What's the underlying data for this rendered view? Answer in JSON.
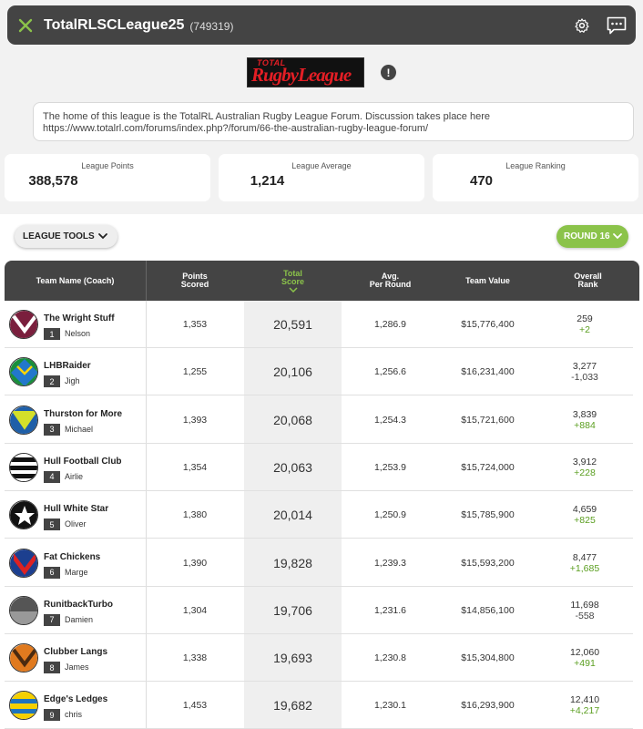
{
  "header": {
    "title": "TotalRLSCLeague25",
    "league_id": "(749319)"
  },
  "logo": {
    "line1": "TOTAL",
    "line2": "RugbyLeague"
  },
  "description": "The home of this league is the TotalRL Australian Rugby League Forum. Discussion takes place here https://www.totalrl.com/forums/index.php?/forum/66-the-australian-rugby-league-forum/",
  "stats": [
    {
      "label": "League Points",
      "value": "388,578"
    },
    {
      "label": "League Average",
      "value": "1,214"
    },
    {
      "label": "League Ranking",
      "value": "470"
    }
  ],
  "controls": {
    "tools_label": "LEAGUE TOOLS",
    "round_label": "ROUND 16"
  },
  "columns": {
    "team": "Team Name (Coach)",
    "points_l1": "Points",
    "points_l2": "Scored",
    "total_l1": "Total",
    "total_l2": "Score",
    "avg_l1": "Avg.",
    "avg_l2": "Per Round",
    "value": "Team Value",
    "overall_l1": "Overall",
    "overall_l2": "Rank"
  },
  "accent": "#8bc34a",
  "rows": [
    {
      "team": "The Wright Stuff",
      "rank": "1",
      "coach": "Nelson",
      "points": "1,353",
      "total": "20,591",
      "avg": "1,286.9",
      "value": "$15,776,400",
      "overall": "259",
      "change": "+2",
      "dir": "up"
    },
    {
      "team": "LHBRaider",
      "rank": "2",
      "coach": "Jigh",
      "points": "1,255",
      "total": "20,106",
      "avg": "1,256.6",
      "value": "$16,231,400",
      "overall": "3,277",
      "change": "-1,033",
      "dir": "down"
    },
    {
      "team": "Thurston for More",
      "rank": "3",
      "coach": "Michael",
      "points": "1,393",
      "total": "20,068",
      "avg": "1,254.3",
      "value": "$15,721,600",
      "overall": "3,839",
      "change": "+884",
      "dir": "up"
    },
    {
      "team": "Hull Football Club",
      "rank": "4",
      "coach": "Airlie",
      "points": "1,354",
      "total": "20,063",
      "avg": "1,253.9",
      "value": "$15,724,000",
      "overall": "3,912",
      "change": "+228",
      "dir": "up"
    },
    {
      "team": "Hull White Star",
      "rank": "5",
      "coach": "Oliver",
      "points": "1,380",
      "total": "20,014",
      "avg": "1,250.9",
      "value": "$15,785,900",
      "overall": "4,659",
      "change": "+825",
      "dir": "up"
    },
    {
      "team": "Fat Chickens",
      "rank": "6",
      "coach": "Marge",
      "points": "1,390",
      "total": "19,828",
      "avg": "1,239.3",
      "value": "$15,593,200",
      "overall": "8,477",
      "change": "+1,685",
      "dir": "up"
    },
    {
      "team": "RunitbackTurbo",
      "rank": "7",
      "coach": "Damien",
      "points": "1,304",
      "total": "19,706",
      "avg": "1,231.6",
      "value": "$14,856,100",
      "overall": "11,698",
      "change": "-558",
      "dir": "down"
    },
    {
      "team": "Clubber Langs",
      "rank": "8",
      "coach": "James",
      "points": "1,338",
      "total": "19,693",
      "avg": "1,230.8",
      "value": "$15,304,800",
      "overall": "12,060",
      "change": "+491",
      "dir": "up"
    },
    {
      "team": "Edge's Ledges",
      "rank": "9",
      "coach": "chris",
      "points": "1,453",
      "total": "19,682",
      "avg": "1,230.1",
      "value": "$16,293,900",
      "overall": "12,410",
      "change": "+4,217",
      "dir": "up"
    }
  ]
}
